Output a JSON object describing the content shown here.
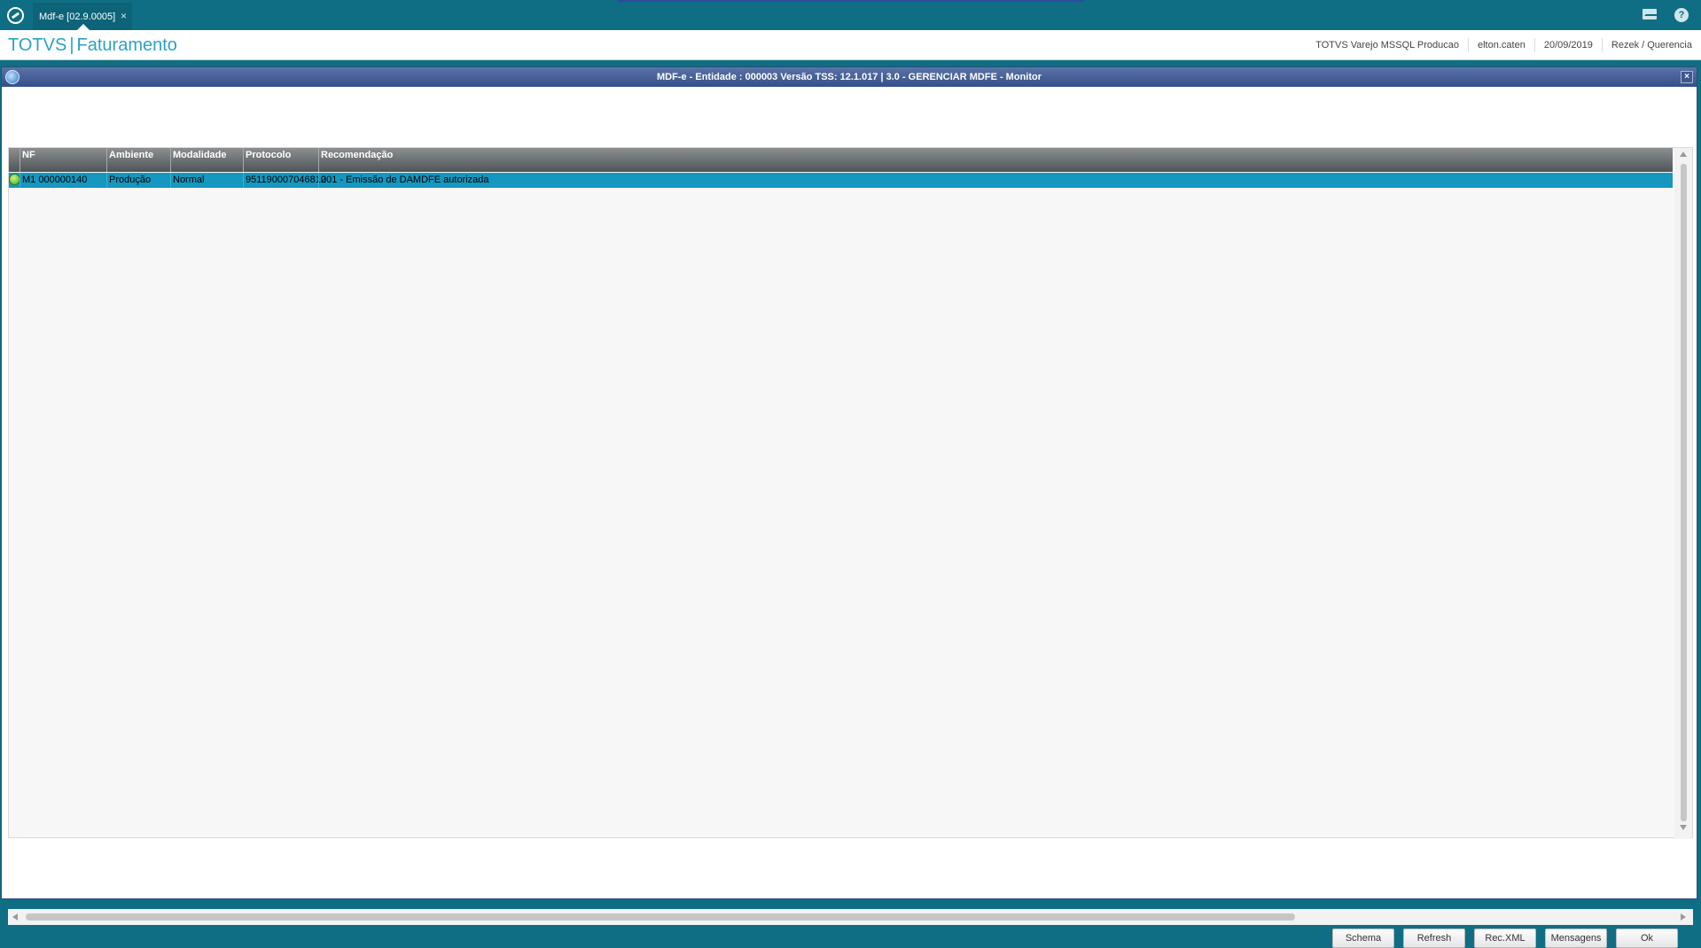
{
  "topbar": {
    "tab_label": "Mdf-e [02.9.0005]",
    "tab_close": "×",
    "help_glyph": "?"
  },
  "header": {
    "brand": "TOTVS",
    "module": "Faturamento",
    "environment": "TOTVS Varejo MSSQL Producao",
    "user": "elton.caten",
    "date": "20/09/2019",
    "company": "Rezek / Querencia"
  },
  "dialog": {
    "title": "MDF-e - Entidade : 000003 Versão TSS: 12.1.017 | 3.0 - GERENCIAR MDFE - Monitor",
    "close": "×"
  },
  "grid": {
    "columns": [
      "NF",
      "Ambiente",
      "Modalidade",
      "Protocolo",
      "Recomendação"
    ],
    "rows": [
      {
        "status": "green",
        "nf": "M1 000000140",
        "ambiente": "Produção",
        "modalidade": "Normal",
        "protocolo": "951190007046812",
        "recomendacao": "001 - Emissão de DAMDFE autorizada"
      }
    ]
  },
  "buttons": {
    "schema": "Schema",
    "refresh": "Refresh",
    "rec_xml": "Rec.XML",
    "mensagens": "Mensagens",
    "ok": "Ok"
  },
  "colors": {
    "topbar": "#0f6e83",
    "brand_text": "#2aa3c0",
    "dialog_title": "#3f5b95",
    "selected_row": "#1597bf",
    "status_ok": "#45a516"
  }
}
